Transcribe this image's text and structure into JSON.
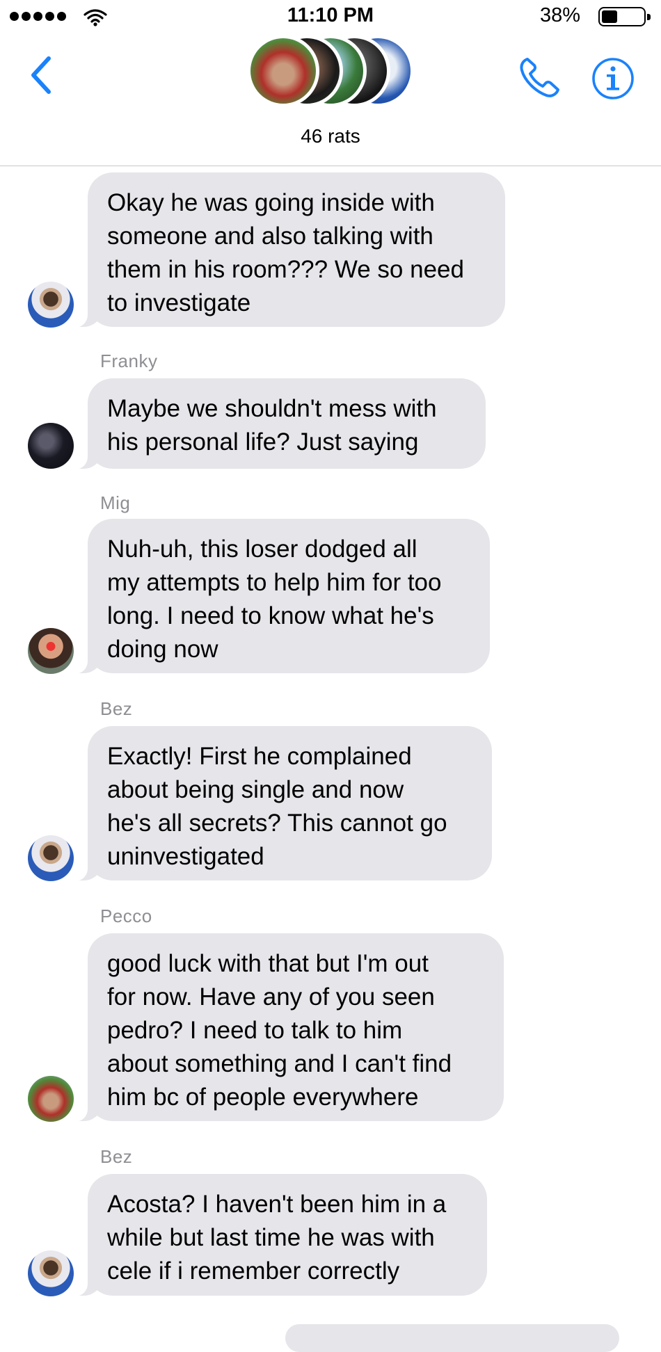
{
  "status_bar": {
    "time": "11:10 PM",
    "battery_percent": "38%",
    "battery_level": 0.38
  },
  "header": {
    "group_name": "46 rats",
    "back_icon": "chevron-left-icon",
    "call_icon": "phone-icon",
    "info_icon": "info-icon",
    "accent_color": "#1a82fb"
  },
  "messages": [
    {
      "sender": "",
      "lines": [
        "Okay he was going inside with",
        "someone and also talking with",
        "them in his room??? We so need",
        "to investigate"
      ]
    },
    {
      "sender": "Franky",
      "lines": [
        "Maybe we shouldn't mess with",
        "his personal life? Just saying"
      ]
    },
    {
      "sender": "Mig",
      "lines": [
        "Nuh-uh, this loser dodged all",
        "my attempts to help him for too",
        "long. I need to know what he's",
        "doing now"
      ]
    },
    {
      "sender": "Bez",
      "lines": [
        "Exactly! First he complained",
        "about being single and now",
        "he's all secrets? This cannot go",
        "uninvestigated"
      ]
    },
    {
      "sender": "Pecco",
      "lines": [
        "good luck with that but I'm out",
        "for now. Have any of you seen",
        "pedro? I need to talk to him",
        "about something and I can't find",
        "him bc of people everywhere"
      ]
    },
    {
      "sender": "Bez",
      "lines": [
        "Acosta? I haven't been him in a",
        "while but last time he was with",
        "cele if i remember correctly"
      ]
    }
  ]
}
